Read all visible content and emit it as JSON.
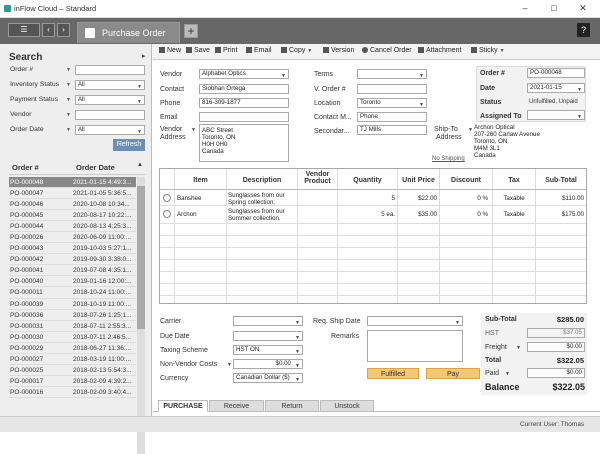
{
  "app": {
    "title": "inFlow Cloud – Standard"
  },
  "tab": {
    "label": "Purchase Order",
    "add": "+",
    "help": "?"
  },
  "search": {
    "heading": "Search",
    "fields": [
      {
        "label": "Order #",
        "value": ""
      },
      {
        "label": "Inventory Status",
        "value": "All"
      },
      {
        "label": "Payment Status",
        "value": "All"
      },
      {
        "label": "Vendor",
        "value": ""
      },
      {
        "label": "Order Date",
        "value": "All"
      }
    ],
    "refresh": "Refresh"
  },
  "list": {
    "headers": [
      "Order #",
      "Order Date"
    ],
    "rows": [
      [
        "PO-000048",
        "2021-01-15 4:49:3..."
      ],
      [
        "PO-000047",
        "2021-01-05 5:36:5..."
      ],
      [
        "PO-000046",
        "2020-10-08 10:34..."
      ],
      [
        "PO-000045",
        "2020-08-17 10:22:..."
      ],
      [
        "PO-000044",
        "2020-08-13 4:25:3..."
      ],
      [
        "PO-000026",
        "2020-06-09 11:00:..."
      ],
      [
        "PO-000043",
        "2019-10-03 5:27:1..."
      ],
      [
        "PO-000042",
        "2019-09-30 3:38:0..."
      ],
      [
        "PO-000041",
        "2019-07-08 4:35:1..."
      ],
      [
        "PO-000040",
        "2019-01-16 12:00:..."
      ],
      [
        "PO-000011",
        "2018-10-24 11:00:..."
      ],
      [
        "PO-000039",
        "2018-10-19 11:00:..."
      ],
      [
        "PO-000036",
        "2018-07-26 1:25:1..."
      ],
      [
        "PO-000031",
        "2018-07-11 2:55:3..."
      ],
      [
        "PO-000030",
        "2018-07-11 2:46:5..."
      ],
      [
        "PO-000029",
        "2018-06-27 11:36:..."
      ],
      [
        "PO-000027",
        "2018-03-19 11:00:..."
      ],
      [
        "PO-000025",
        "2018-02-13 5:54:3..."
      ],
      [
        "PO-000017",
        "2018-02-09 4:39:2..."
      ],
      [
        "PO-000016",
        "2018-02-09 3:40:4..."
      ]
    ]
  },
  "toolbar": {
    "new": "New",
    "save": "Save",
    "print": "Print",
    "email": "Email",
    "copy": "Copy",
    "version": "Version",
    "cancel": "Cancel Order",
    "attachment": "Attachment",
    "sticky": "Sticky"
  },
  "form": {
    "vendor_label": "Vendor",
    "vendor": "Alphabet Optics",
    "contact_label": "Contact",
    "contact": "Siobhan Ortega",
    "phone_label": "Phone",
    "phone": "816-309-1877",
    "email_label": "Email",
    "email": "",
    "vaddr_label1": "Vendor",
    "vaddr_label2": "Address",
    "vaddr": [
      "ABC Street",
      "Toronto, ON",
      "H0H 0H0",
      "Canada"
    ],
    "terms_label": "Terms",
    "terms": "",
    "vorder_label": "V. Order #",
    "vorder": "",
    "location_label": "Location",
    "location": "Toronto",
    "contactm_label": "Contact M...",
    "contactm": "Phone",
    "secondary_label": "Secondar...",
    "secondary": "TJ Mills",
    "shipto_label1": "Ship-To",
    "shipto_label2": "Address",
    "shipto": [
      "Archon Optical",
      "207-260 Carlaw Avenue",
      "Toronto, ON",
      "M4M 3L1",
      "Canada"
    ],
    "noshipping": "No Shipping",
    "order_label": "Order #",
    "order": "PO-000048",
    "date_label": "Date",
    "date": "2021-01-15",
    "status_label": "Status",
    "status": "Unfulfilled, Unpaid",
    "assigned_label": "Assigned To",
    "assigned": ""
  },
  "items": {
    "headers": [
      "Item",
      "Description",
      "Vendor Product",
      "Quantity",
      "Unit Price",
      "Discount",
      "Tax",
      "Sub-Total"
    ],
    "rows": [
      {
        "item": "Banshee",
        "desc": "Sunglasses from our Spring collection.",
        "qty": "5",
        "price": "$22.00",
        "disc": "0 %",
        "tax": "Taxable",
        "sub": "$110.00"
      },
      {
        "item": "Archon",
        "desc": "Sunglasses from our Summer collection.",
        "qty": "5 ea.",
        "price": "$35.00",
        "disc": "0 %",
        "tax": "Taxable",
        "sub": "$175.00"
      }
    ]
  },
  "bottom": {
    "carrier_label": "Carrier",
    "carrier": "",
    "due_label": "Due Date",
    "due": "",
    "taxing_label": "Taxing Scheme",
    "taxing": "HST ON",
    "nvc_label": "Non-Vendor Costs",
    "nvc": "$0.00",
    "currency_label": "Currency",
    "currency": "Canadian Dollar ($)",
    "reqship_label": "Req. Ship Date",
    "reqship": "",
    "remarks_label": "Remarks",
    "fulfilled": "Fulfilled",
    "pay": "Pay",
    "subtotal_label": "Sub-Total",
    "subtotal": "$285.00",
    "hst_label": "HST",
    "hst": "$37.05",
    "freight_label": "Freight",
    "freight": "$0.00",
    "total_label": "Total",
    "total": "$322.05",
    "paid_label": "Paid",
    "paid": "$0.00",
    "balance_label": "Balance",
    "balance": "$322.05"
  },
  "bottom_tabs": [
    "PURCHASE",
    "Receive",
    "Return",
    "Unstock"
  ],
  "status": {
    "user": "Current User:  Thomas"
  }
}
